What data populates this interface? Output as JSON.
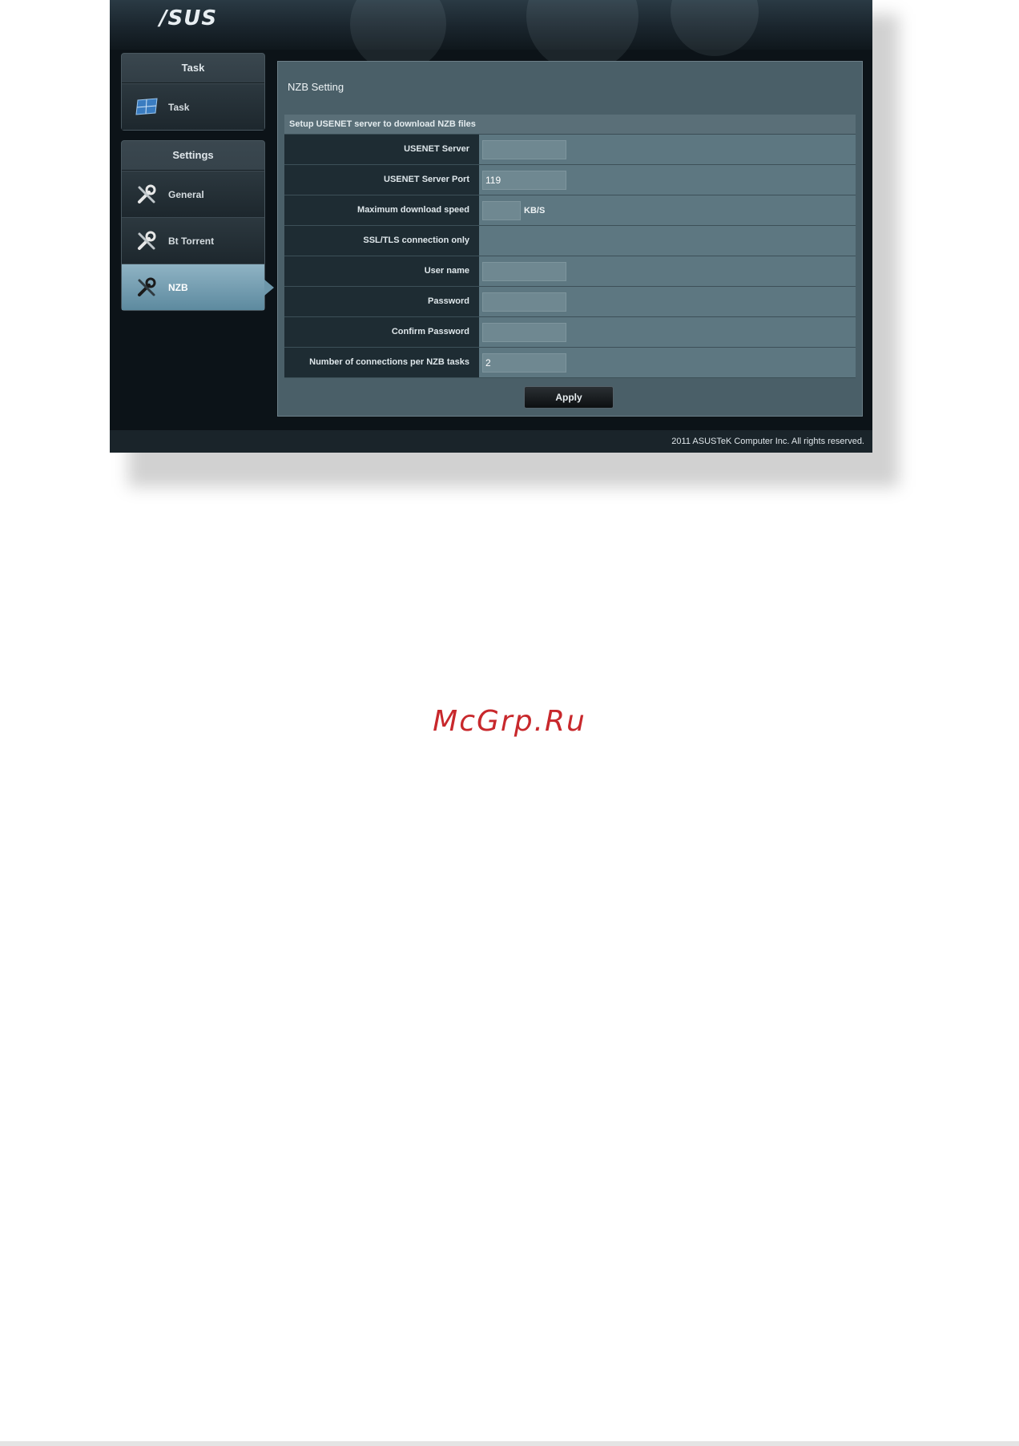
{
  "brand": {
    "logo_text": "/SUS"
  },
  "sidebar": {
    "task_section": {
      "title": "Task",
      "items": [
        {
          "label": "Task",
          "icon": "task-icon"
        }
      ]
    },
    "settings_section": {
      "title": "Settings",
      "items": [
        {
          "label": "General",
          "icon": "wrench-icon"
        },
        {
          "label": "Bt Torrent",
          "icon": "wrench-icon"
        },
        {
          "label": "NZB",
          "icon": "wrench-icon",
          "active": true
        }
      ]
    }
  },
  "main": {
    "title": "NZB Setting",
    "table_caption": "Setup USENET server to download NZB files",
    "fields": {
      "usenet_server": {
        "label": "USENET Server",
        "value": ""
      },
      "usenet_server_port": {
        "label": "USENET Server Port",
        "value": "119"
      },
      "max_download_speed": {
        "label": "Maximum download speed",
        "value": "",
        "unit": "KB/S"
      },
      "ssl_tls_only": {
        "label": "SSL/TLS connection only"
      },
      "user_name": {
        "label": "User name",
        "value": ""
      },
      "password": {
        "label": "Password",
        "value": ""
      },
      "confirm_password": {
        "label": "Confirm Password",
        "value": ""
      },
      "connections_per_task": {
        "label": "Number of connections per NZB tasks",
        "value": "2"
      }
    },
    "apply_label": "Apply"
  },
  "footer": {
    "copyright": "2011 ASUSTeK Computer Inc. All rights reserved."
  },
  "watermark": {
    "text": "McGrp.Ru"
  },
  "colors": {
    "active_item": "#6e97aa",
    "background": "#0c1318",
    "watermark": "#c8282c"
  }
}
